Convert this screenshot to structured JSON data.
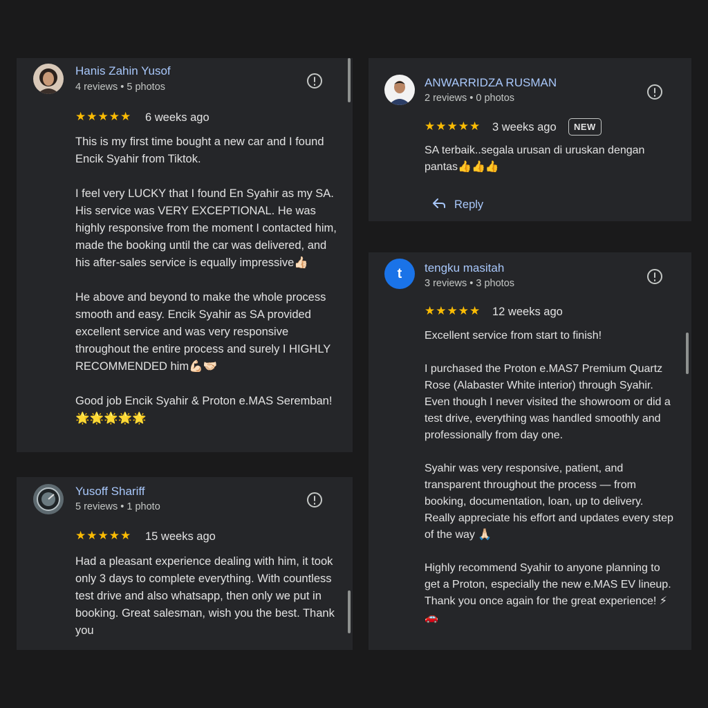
{
  "reviews": [
    {
      "name": "Hanis Zahin Yusof",
      "meta": "4 reviews • 5 photos",
      "stars": "★★★★★",
      "when": "6 weeks ago",
      "text": "This is my first time bought a new car and I found Encik Syahir from Tiktok.\n\nI feel very LUCKY that I found En Syahir as my SA. His service was VERY EXCEPTIONAL. He was highly responsive from the moment I contacted him, made the booking until the car was delivered, and his after-sales service is equally impressive👍🏻\n\nHe above and beyond to make the whole process smooth and easy. Encik Syahir as SA provided excellent service and was very responsive throughout the entire process and surely I HIGHLY RECOMMENDED him💪🏻🤝🏻\n\nGood job Encik Syahir & Proton e.MAS Seremban!🌟🌟🌟🌟🌟"
    },
    {
      "name": "Yusoff Shariff",
      "meta": "5 reviews • 1 photo",
      "stars": "★★★★★",
      "when": "15 weeks ago",
      "text": "Had a pleasant experience dealing with him, it took only 3 days to complete everything. With countless test drive and also whatsapp, then only we put in booking. Great salesman, wish you the best. Thank you"
    },
    {
      "name": "ANWARRIDZA RUSMAN",
      "meta": "2 reviews • 0 photos",
      "stars": "★★★★★",
      "when": "3 weeks ago",
      "badge": "NEW",
      "text": "SA terbaik..segala urusan di uruskan dengan pantas👍👍👍",
      "reply": "Reply"
    },
    {
      "name": "tengku masitah",
      "avatar_letter": "t",
      "meta": "3 reviews • 3 photos",
      "stars": "★★★★★",
      "when": "12 weeks ago",
      "text": "Excellent service from start to finish!\n\nI purchased the Proton e.MAS7 Premium Quartz Rose (Alabaster White interior) through Syahir. Even though I never visited the showroom or did a test drive, everything was handled smoothly and professionally from day one.\n\nSyahir was very responsive, patient, and transparent throughout the process — from booking, documentation, loan, up to delivery. Really appreciate his effort and updates every step of the way 🙏🏻\n\nHighly recommend Syahir to anyone planning to get a Proton, especially the new e.MAS EV lineup. Thank you once again for the great experience! ⚡🚗"
    }
  ],
  "colors": {
    "background": "#1a1a1b",
    "card": "#252629",
    "name": "#a8c7fa",
    "star": "#fbbc04",
    "avatar_letter_bg": "#1a73e8"
  }
}
